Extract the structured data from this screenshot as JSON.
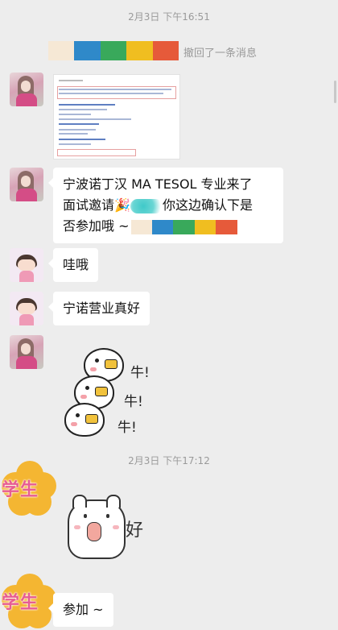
{
  "timestamps": [
    "2月3日 下午16:51",
    "2月3日 下午17:12"
  ],
  "recall": {
    "text": "撤回了一条消息",
    "mosaic_colors": [
      "#f6e8d5",
      "#2f89c9",
      "#39a95b",
      "#f0be20",
      "#e65a3a"
    ]
  },
  "messages": {
    "invite_line1": "宁波诺丁汉 MA TESOL 专业来了",
    "invite_line2_a": "面试邀请🎉",
    "invite_line2_b": "你这边确认下是",
    "invite_line3": "否参加哦 ~",
    "wa": "哇哦",
    "ningnuo": "宁诺营业真好",
    "cansan": "参加 ~"
  },
  "stickers": {
    "niu": "牛!",
    "hao": "好"
  },
  "student_avatar_label": "学生"
}
